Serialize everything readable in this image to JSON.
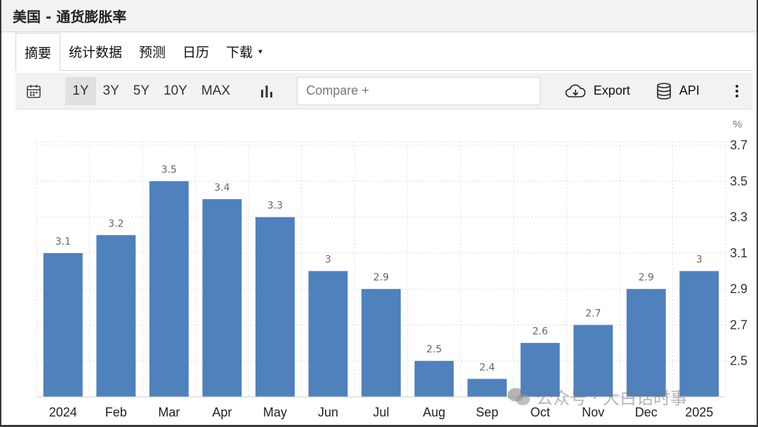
{
  "title": "美国 - 通货膨胀率",
  "tabs": [
    {
      "label": "摘要",
      "active": true
    },
    {
      "label": "统计数据"
    },
    {
      "label": "预测"
    },
    {
      "label": "日历"
    },
    {
      "label": "下载",
      "caret": "▾"
    }
  ],
  "toolbar": {
    "ranges": [
      "1Y",
      "3Y",
      "5Y",
      "10Y",
      "MAX"
    ],
    "active_range": "1Y",
    "compare_placeholder": "Compare +",
    "export_label": "Export",
    "api_label": "API",
    "icons": {
      "calendar": "calendar-icon",
      "chart_type": "bar-chart-icon",
      "export": "cloud-download-icon",
      "api": "database-icon",
      "more": "more-vertical-icon"
    }
  },
  "watermark": "公众号 · 大白话时事",
  "chart_data": {
    "type": "bar",
    "categories": [
      "2024",
      "Feb",
      "Mar",
      "Apr",
      "May",
      "Jun",
      "Jul",
      "Aug",
      "Sep",
      "Oct",
      "Nov",
      "Dec",
      "2025"
    ],
    "values": [
      3.1,
      3.2,
      3.5,
      3.4,
      3.3,
      3,
      2.9,
      2.5,
      2.4,
      2.6,
      2.7,
      2.9,
      3
    ],
    "value_labels": [
      "3.1",
      "3.2",
      "3.5",
      "3.4",
      "3.3",
      "3",
      "2.9",
      "2.5",
      "2.4",
      "2.6",
      "2.7",
      "2.9",
      "3"
    ],
    "y_unit": "%",
    "y_ticks": [
      "3.7",
      "3.5",
      "3.3",
      "3.1",
      "2.9",
      "2.7",
      "2.5"
    ],
    "y_tick_values": [
      3.7,
      3.5,
      3.3,
      3.1,
      2.9,
      2.7,
      2.5
    ],
    "ylim": [
      2.3,
      3.72
    ],
    "bar_color": "#4f81bd",
    "grid": true,
    "y_axis_position": "right"
  }
}
